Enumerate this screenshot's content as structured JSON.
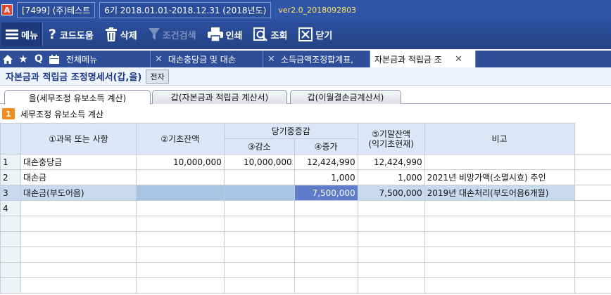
{
  "titlebar": {
    "logo": "A",
    "company": "[7499] (주)테스트",
    "period": "6기 2018.01.01-2018.12.31 (2018년도)",
    "version": "ver2.0_2018092803"
  },
  "toolbar": {
    "menu": "메뉴",
    "code_help": "코드도움",
    "delete": "삭제",
    "filter": "조건검색",
    "print": "인쇄",
    "search": "조회",
    "close": "닫기"
  },
  "tabstrip": {
    "all_menu": "전체메뉴",
    "tabs": [
      {
        "label": "대손충당금 및 대손"
      },
      {
        "label": "소득금액조정합계표,"
      },
      {
        "label": "자본금과 적립금 조"
      }
    ]
  },
  "form": {
    "title": "자본금과 적립금 조정명세서(갑,을)",
    "button": "전자"
  },
  "subtabs": [
    {
      "label": "을(세무조정 유보소득 계산)"
    },
    {
      "label": "갑(자본금과 적립금 계산서)"
    },
    {
      "label": "갑(이월결손금계산서)"
    }
  ],
  "section": {
    "number": "1",
    "label": "세무조정 유보소득 계산"
  },
  "grid": {
    "headers": {
      "item": "①과목 또는 사항",
      "begin": "②기초잔액",
      "change": "당기중증감",
      "decrease": "③감소",
      "increase": "④증가",
      "end": "⑤기말잔액",
      "end_sub": "(익기초현재)",
      "note": "비고"
    },
    "rows": [
      {
        "no": "1",
        "item": "대손충당금",
        "begin": "10,000,000",
        "decrease": "10,000,000",
        "increase": "12,424,990",
        "end": "12,424,990",
        "note": ""
      },
      {
        "no": "2",
        "item": "대손금",
        "begin": "",
        "decrease": "",
        "increase": "1,000",
        "end": "1,000",
        "note": "2021년 비망가액(소멸시효) 추인"
      },
      {
        "no": "3",
        "item": "대손금(부도어음)",
        "begin": "",
        "decrease": "",
        "increase": "7,500,000",
        "end": "7,500,000",
        "note": "2019년 대손처리(부도어음6개월)"
      },
      {
        "no": "4",
        "item": "",
        "begin": "",
        "decrease": "",
        "increase": "",
        "end": "",
        "note": ""
      }
    ]
  }
}
